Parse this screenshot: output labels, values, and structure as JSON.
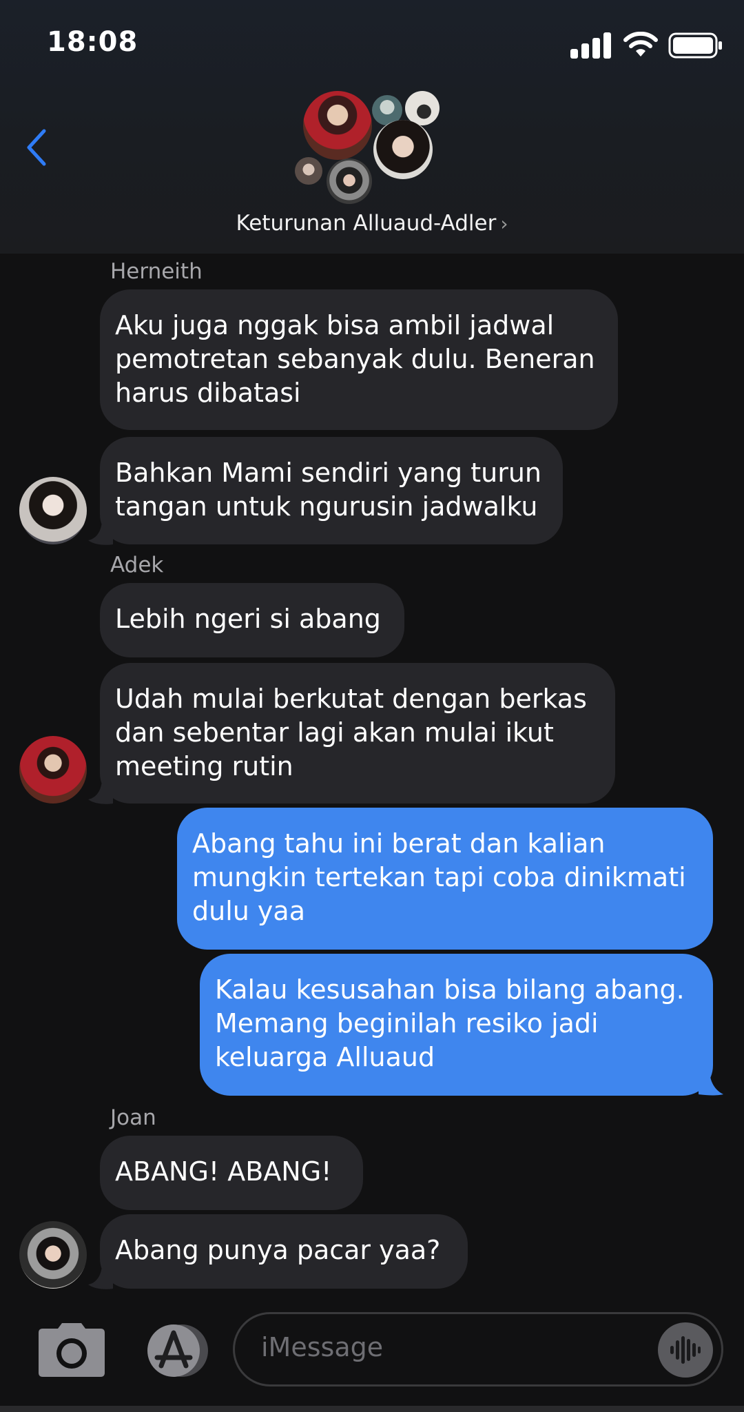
{
  "status": {
    "time": "18:08"
  },
  "header": {
    "group_name": "Keturunan Alluaud-Adler",
    "chevron": "›"
  },
  "messages": [
    {
      "sender": "Herneith",
      "text": "Aku juga nggak bisa ambil jadwal\npemotretan sebanyak dulu. Beneran\nharus dibatasi"
    },
    {
      "text": "Bahkan Mami sendiri yang turun\ntangan untuk ngurusin jadwalku"
    },
    {
      "sender": "Adek",
      "text": "Lebih ngeri si abang"
    },
    {
      "text": "Udah mulai berkutat dengan berkas\ndan sebentar lagi akan mulai ikut\nmeeting rutin"
    },
    {
      "text": "Abang tahu ini berat dan kalian\nmungkin tertekan tapi coba dinikmati\ndulu yaa"
    },
    {
      "text": "Kalau kesusahan bisa bilang abang.\nMemang beginilah resiko jadi\nkeluarga Alluaud"
    },
    {
      "sender": "Joan",
      "text": "ABANG! ABANG!"
    },
    {
      "text": "Abang punya pacar yaa?"
    }
  ],
  "composer": {
    "placeholder": "iMessage"
  },
  "colors": {
    "incoming": "#26262a",
    "outgoing": "#3f86ee",
    "accent": "#2f7cf6",
    "background": "#111112"
  },
  "icons": [
    "signal-icon",
    "wifi-icon",
    "battery-icon",
    "back-chevron-icon",
    "camera-icon",
    "app-store-icon",
    "audio-waveform-icon"
  ]
}
